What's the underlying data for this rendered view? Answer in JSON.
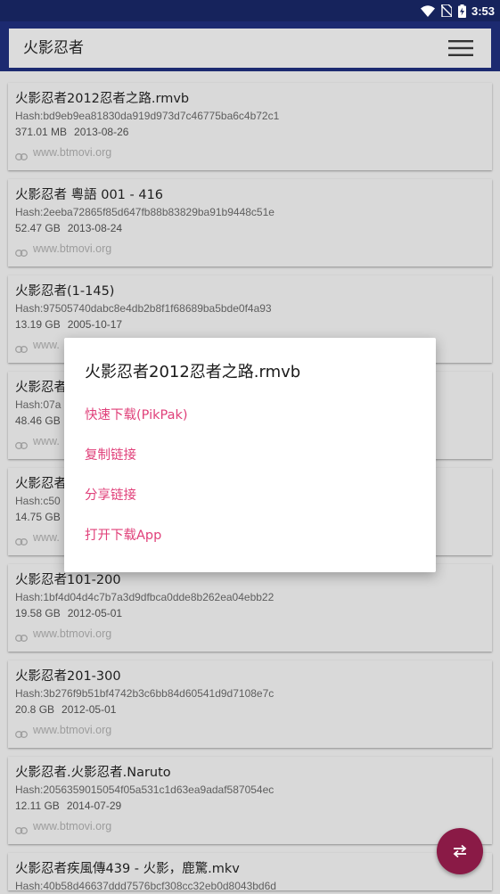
{
  "status_bar": {
    "time": "3:53",
    "icons": [
      "wifi-icon",
      "no-sim-icon",
      "battery-charging-icon"
    ]
  },
  "header": {
    "search_text": "火影忍者",
    "menu_icon": "menu-icon"
  },
  "results": [
    {
      "name": "火影忍者2012忍者之路.rmvb",
      "hash": "Hash:bd9eb9ea81830da919d973d7c46775ba6c4b72c1",
      "size": "371.01 MB",
      "date": "2013-08-26",
      "source": "www.btmovi.org"
    },
    {
      "name": "火影忍者 粵語 001 - 416",
      "hash": "Hash:2eeba72865f85d647fb88b83829ba91b9448c51e",
      "size": "52.47 GB",
      "date": "2013-08-24",
      "source": "www.btmovi.org"
    },
    {
      "name": "火影忍者(1-145)",
      "hash": "Hash:97505740dabc8e4db2b8f1f68689ba5bde0f4a93",
      "size": "13.19 GB",
      "date": "2005-10-17",
      "source": "www."
    },
    {
      "name": "火影忍者",
      "hash": "Hash:07a",
      "size": "48.46 GB",
      "date": "",
      "source": "www."
    },
    {
      "name": "火影忍者",
      "hash": "Hash:c50",
      "size": "14.75 GB",
      "date": "",
      "source": "www."
    },
    {
      "name": "火影忍者101-200",
      "hash": "Hash:1bf4d04d4c7b7a3d9dfbca0dde8b262ea04ebb22",
      "size": "19.58 GB",
      "date": "2012-05-01",
      "source": "www.btmovi.org"
    },
    {
      "name": "火影忍者201-300",
      "hash": "Hash:3b276f9b51bf4742b3c6bb84d60541d9d7108e7c",
      "size": "20.8 GB",
      "date": "2012-05-01",
      "source": "www.btmovi.org"
    },
    {
      "name": "火影忍者.火影忍者.Naruto",
      "hash": "Hash:2056359015054f05a531c1d63ea9adaf587054ec",
      "size": "12.11 GB",
      "date": "2014-07-29",
      "source": "www.btmovi.org"
    },
    {
      "name": "火影忍者疾風傳439 - 火影，鹿驚.mkv",
      "hash": "Hash:40b58d46637ddd7576bcf308cc32eb0d8043bd6d",
      "size": "",
      "date": "",
      "source": ""
    }
  ],
  "fab": {
    "icon": "swap-icon"
  },
  "dialog": {
    "title": "火影忍者2012忍者之路.rmvb",
    "options": [
      "快速下载(PikPak)",
      "复制链接",
      "分享链接",
      "打开下载App"
    ]
  },
  "colors": {
    "status_bar": "#16235c",
    "header": "#1c2a70",
    "accent": "#e0407a",
    "fab": "#8a1a46"
  }
}
